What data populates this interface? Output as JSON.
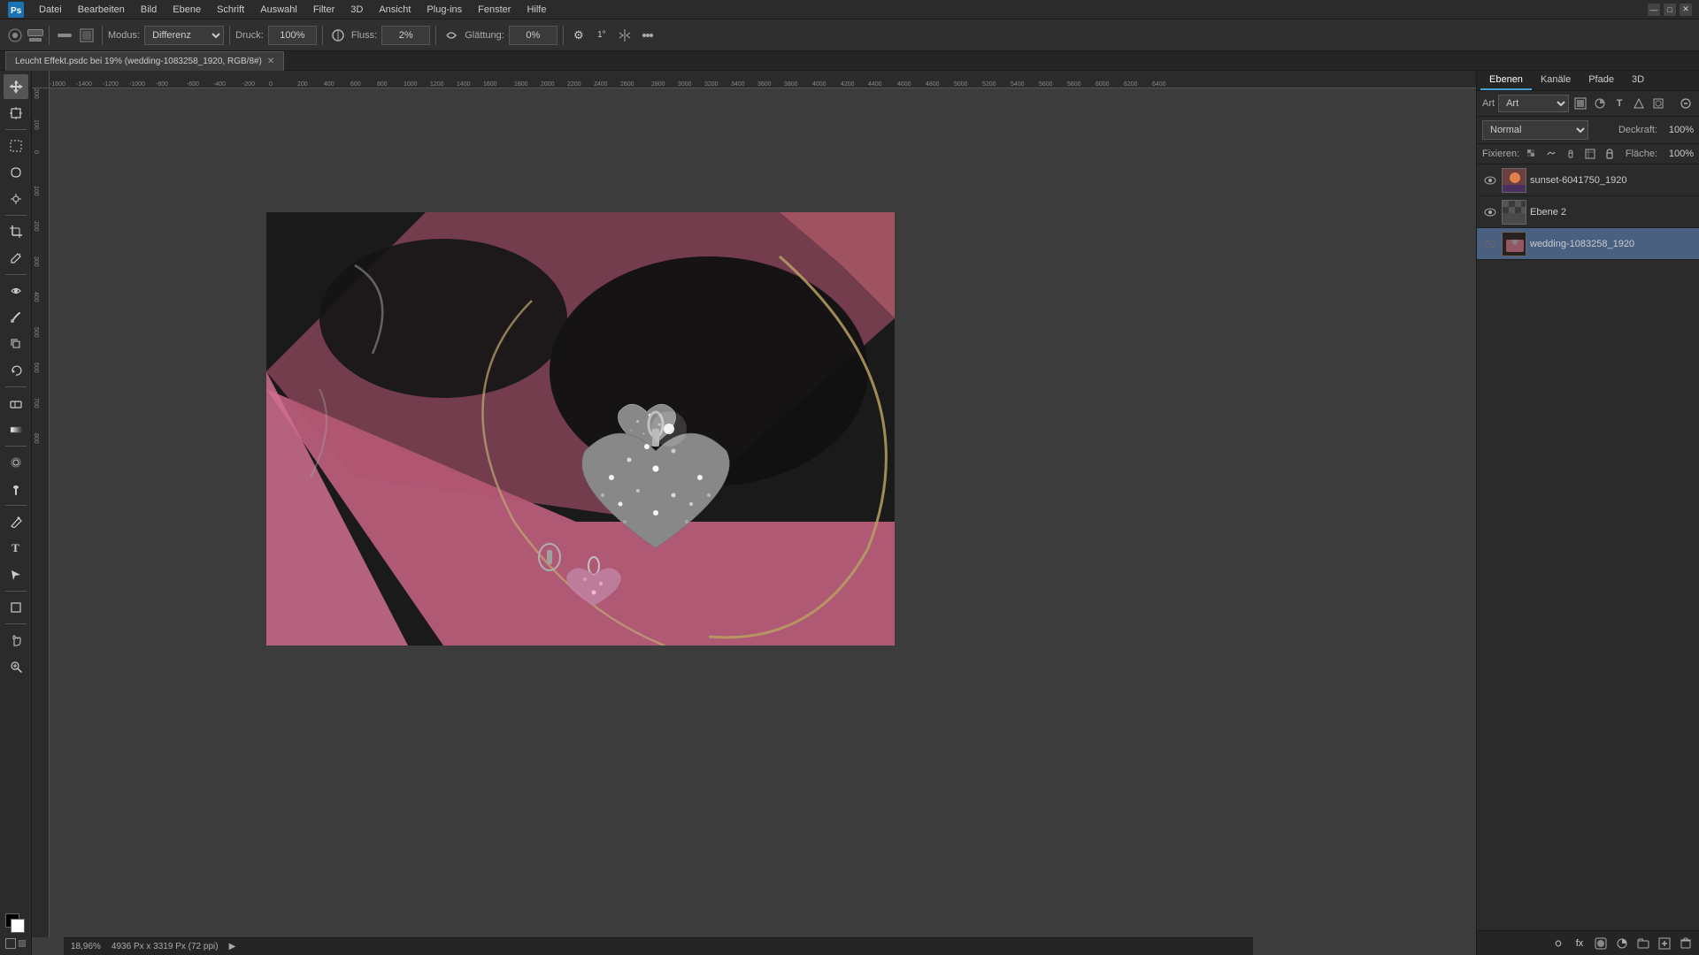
{
  "app": {
    "title": "Adobe Photoshop",
    "logo": "Ps"
  },
  "window_controls": {
    "minimize": "—",
    "maximize": "□",
    "close": "✕"
  },
  "menubar": {
    "items": [
      "Datei",
      "Bearbeiten",
      "Bild",
      "Ebene",
      "Schrift",
      "Auswahl",
      "Filter",
      "3D",
      "Ansicht",
      "Plug-ins",
      "Fenster",
      "Hilfe"
    ]
  },
  "toolbar": {
    "modus_label": "Modus:",
    "modus_value": "Differenz",
    "druck_label": "Druck:",
    "druck_value": "100%",
    "fluss_label": "Fluss:",
    "fluss_value": "2%",
    "glattung_label": "Glättung:",
    "glattung_value": "0%"
  },
  "tabbar": {
    "doc_title": "Leucht Effekt.psdc bei 19% (wedding-1083258_1920, RGB/8#)",
    "close_btn": "✕"
  },
  "canvas": {
    "zoom": "18,96%",
    "doc_size": "4936 Px x 3319 Px (72 ppi)"
  },
  "panel": {
    "tabs": [
      "Ebenen",
      "Kanäle",
      "Pfade",
      "3D"
    ],
    "active_tab": "Ebenen",
    "search_label": "Art",
    "blend_mode": "Normal",
    "opacity_label": "Deckraft:",
    "opacity_value": "100%",
    "lock_label": "Fixieren:",
    "fill_label": "Fläche:",
    "fill_value": "100%",
    "layers": [
      {
        "id": "layer1",
        "name": "sunset-6041750_1920",
        "visible": true,
        "selected": false,
        "thumb_color": "#8B6B5E"
      },
      {
        "id": "layer2",
        "name": "Ebene 2",
        "visible": true,
        "selected": false,
        "thumb_color": "#5A5A5A"
      },
      {
        "id": "layer3",
        "name": "wedding-1083258_1920",
        "visible": false,
        "selected": true,
        "thumb_color": "#3A3030"
      }
    ]
  },
  "status_bar": {
    "zoom_value": "18,96%",
    "doc_info": "4936 Px x 3319 Px (72 ppi)"
  },
  "ruler_h_marks": [
    "-1600",
    "-1400",
    "-1200",
    "-1000",
    "-800",
    "-600",
    "-400",
    "-200",
    "0",
    "200",
    "400",
    "600",
    "800",
    "1000",
    "1200",
    "1400",
    "1600",
    "1800",
    "2000",
    "2200",
    "2400",
    "2600",
    "2800",
    "3000",
    "3200",
    "3400",
    "3600",
    "3800",
    "4000",
    "4200",
    "4400",
    "4600",
    "4800",
    "5000",
    "5200",
    "5400",
    "5600",
    "5800",
    "6000",
    "6200",
    "6400"
  ],
  "ruler_v_marks": [
    "200",
    "100",
    "0",
    "100",
    "200",
    "300",
    "400",
    "500",
    "600",
    "700",
    "800"
  ],
  "left_tools": [
    {
      "icon": "↖",
      "name": "move-tool"
    },
    {
      "icon": "⊹",
      "name": "artboard-tool"
    },
    {
      "icon": "▭",
      "name": "marquee-tool"
    },
    {
      "icon": "⌖",
      "name": "lasso-tool"
    },
    {
      "icon": "✦",
      "name": "magic-wand"
    },
    {
      "icon": "✂",
      "name": "crop-tool"
    },
    {
      "icon": "⊘",
      "name": "eyedropper"
    },
    {
      "icon": "⊕",
      "name": "heal-tool"
    },
    {
      "icon": "🖌",
      "name": "brush-tool"
    },
    {
      "icon": "✏",
      "name": "clone-tool"
    },
    {
      "icon": "◉",
      "name": "history-brush"
    },
    {
      "icon": "◻",
      "name": "eraser-tool"
    },
    {
      "icon": "▦",
      "name": "gradient-tool"
    },
    {
      "icon": "◈",
      "name": "blur-tool"
    },
    {
      "icon": "△",
      "name": "dodge-tool"
    },
    {
      "icon": "⬡",
      "name": "pen-tool"
    },
    {
      "icon": "T",
      "name": "type-tool"
    },
    {
      "icon": "↗",
      "name": "path-selection"
    },
    {
      "icon": "◼",
      "name": "shape-tool"
    },
    {
      "icon": "☞",
      "name": "hand-tool"
    },
    {
      "icon": "🔍",
      "name": "zoom-tool"
    }
  ]
}
